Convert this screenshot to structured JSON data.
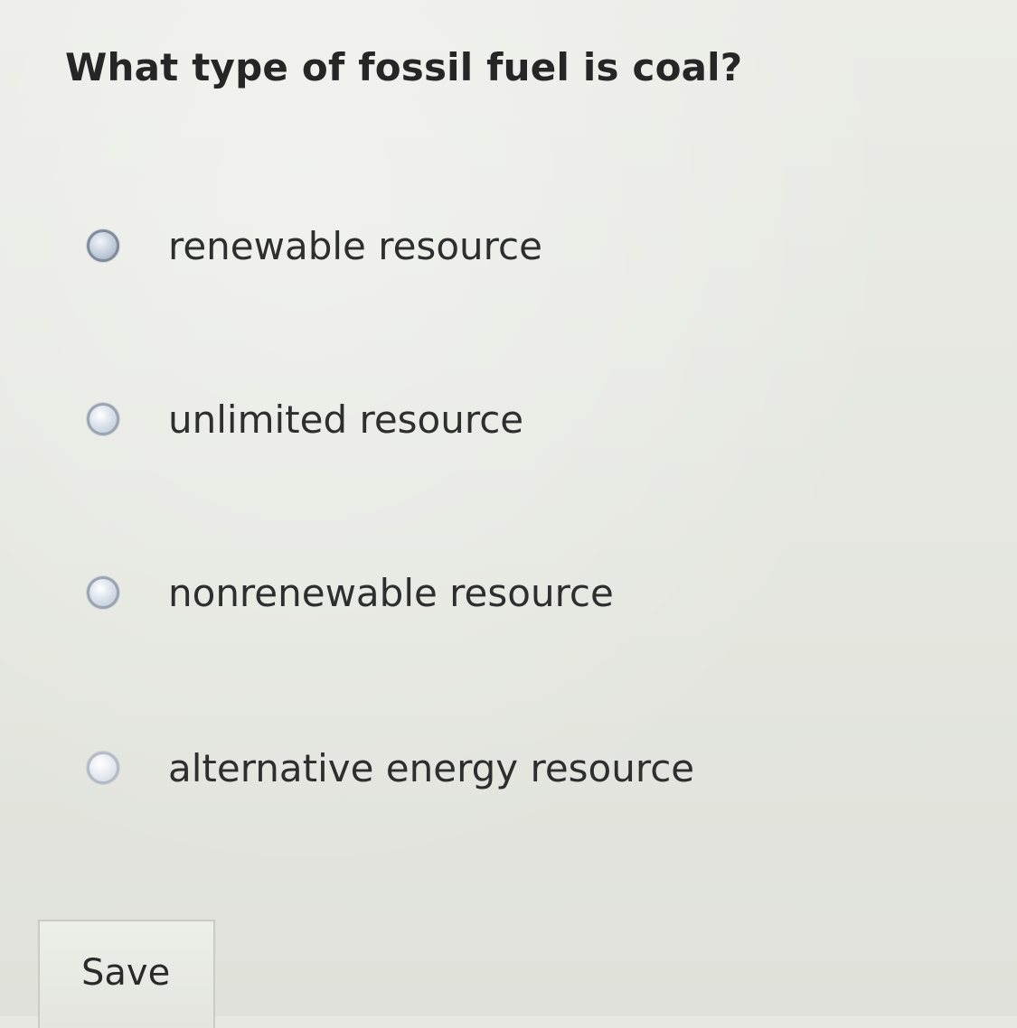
{
  "question": {
    "text": "What type of fossil fuel is coal?"
  },
  "options": [
    {
      "label": "renewable resource",
      "selected": false
    },
    {
      "label": "unlimited resource",
      "selected": false
    },
    {
      "label": "nonrenewable resource",
      "selected": false
    },
    {
      "label": "alternative energy resource",
      "selected": false
    }
  ],
  "actions": {
    "save_label": "Save"
  },
  "colors": {
    "background": "#e7e8e1",
    "text": "#2a2a2a",
    "radio_border": "#9aa3b0"
  }
}
